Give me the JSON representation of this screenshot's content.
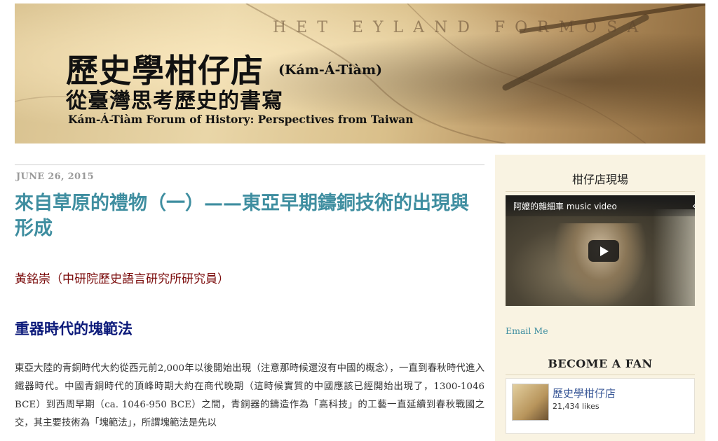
{
  "banner": {
    "map_text": "HET  EYLAND  FORMOSA",
    "title_zh": "歷史學柑仔店",
    "title_latin": "(Kám-Á-Tiàm)",
    "subtitle_zh": "從臺灣思考歷史的書寫",
    "subtitle_en": "Kám-Á-Tiàm Forum of History: Perspectives from Taiwan"
  },
  "post": {
    "date": "JUNE 26, 2015",
    "title": "來自草原的禮物（一）——東亞早期鑄銅技術的出現與形成",
    "author": "黃銘崇（中研院歷史語言研究所研究員）",
    "heading": "重器時代的塊範法",
    "body": "東亞大陸的青銅時代大約從西元前2,000年以後開始出現（注意那時候還沒有中國的概念），一直到春秋時代進入鐵器時代。中國青銅時代的頂峰時期大約在商代晚期（這時候實質的中國應該已經開始出現了，1300-1046 BCE）到西周早期（ca. 1046-950 BCE）之間，青銅器的鑄造作為「高科技」的工藝一直延續到春秋戰國之交，其主要技術為「塊範法」，所謂塊範法是先以"
  },
  "sidebar": {
    "live_title": "柑仔店現場",
    "video": {
      "title": "阿嬤的雜細車 music video"
    },
    "email_label": "Email Me",
    "fan_title": "BECOME A FAN",
    "fb_page": {
      "name": "歷史學柑仔店",
      "likes": "21,434 likes"
    }
  },
  "colors": {
    "title_link": "#3f8ea0",
    "author": "#7a0a0a",
    "heading": "#0c1a7a",
    "sidebar_bg": "#f9f3e2",
    "facebook": "#3b5998"
  }
}
